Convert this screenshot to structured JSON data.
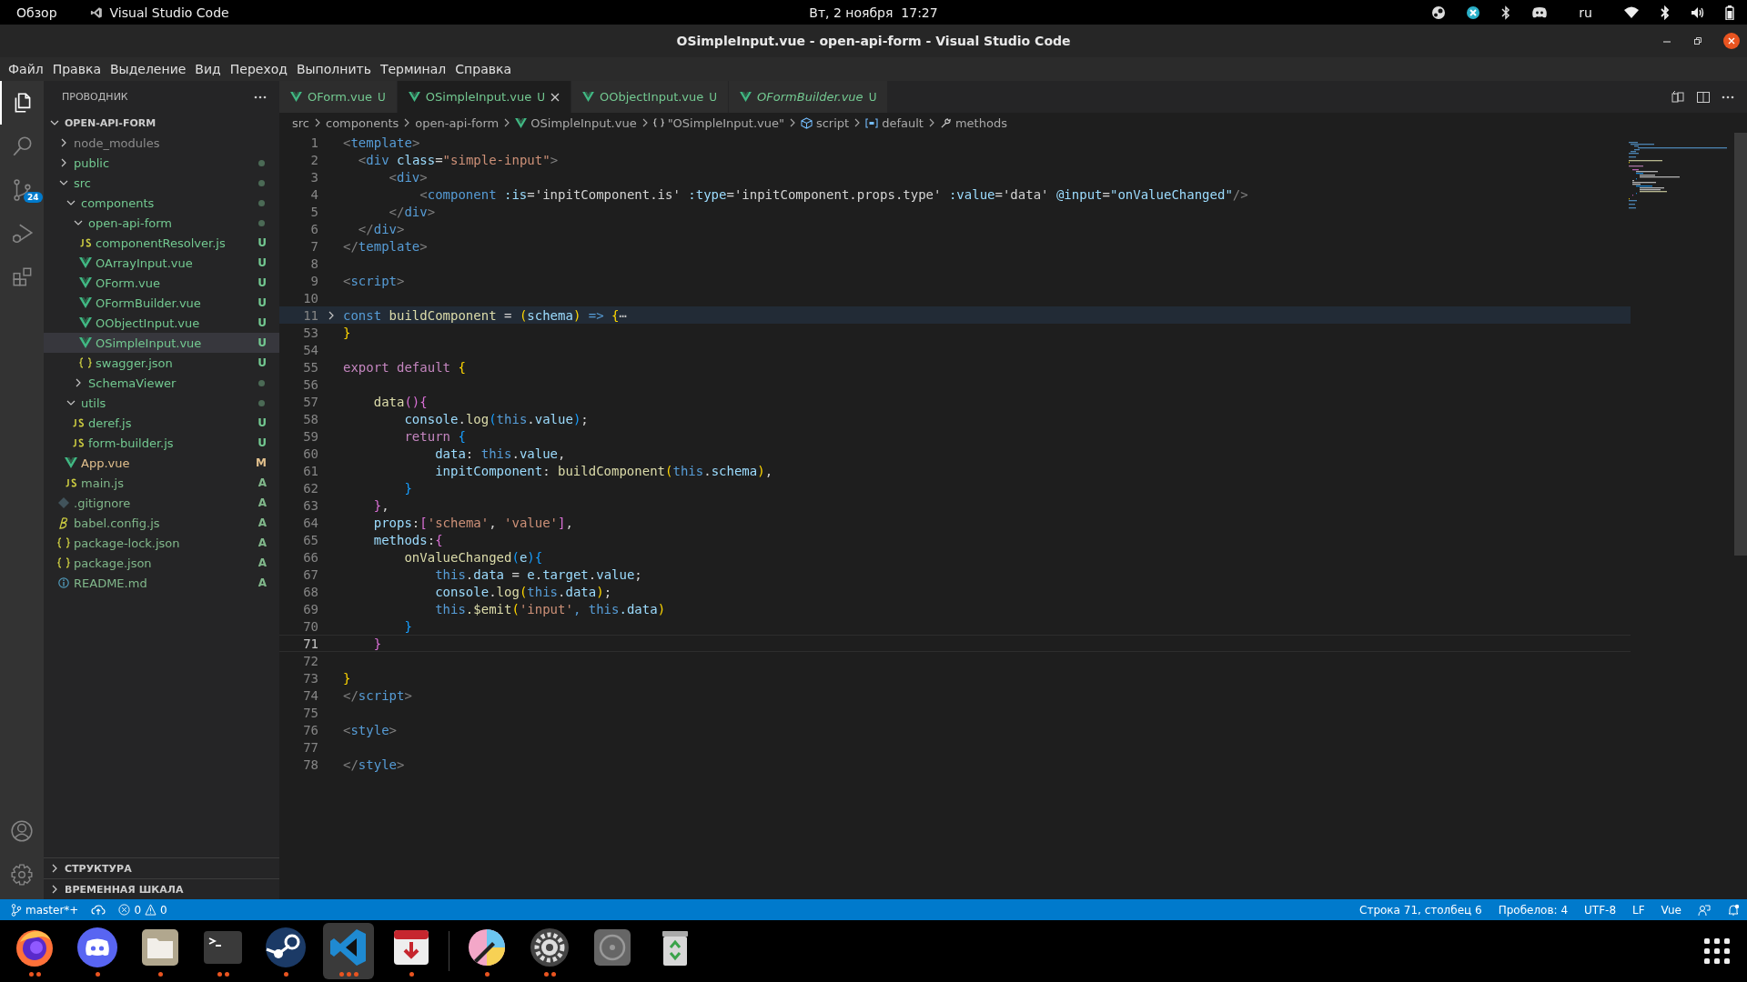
{
  "top_bar": {
    "activities": "Обзор",
    "app": "Visual Studio Code",
    "clock": "Вт, 2 ноября  17:27",
    "keyboard_layout": "ru"
  },
  "window": {
    "title": "OSimpleInput.vue - open-api-form - Visual Studio Code"
  },
  "menu": [
    "Файл",
    "Правка",
    "Выделение",
    "Вид",
    "Переход",
    "Выполнить",
    "Терминал",
    "Справка"
  ],
  "activity_bar": [
    {
      "kind": "explorer",
      "selected": true
    },
    {
      "kind": "search",
      "selected": false
    },
    {
      "kind": "scm",
      "selected": false,
      "badge": "24"
    },
    {
      "kind": "run",
      "selected": false
    },
    {
      "kind": "extensions",
      "selected": false
    }
  ],
  "explorer": {
    "title": "ПРОВОДНИК",
    "root": {
      "name": "OPEN-API-FORM",
      "expanded": true,
      "children": [
        {
          "name": "node_modules",
          "kind": "folder",
          "expanded": false,
          "color": "#8c8c8c",
          "decorated": false,
          "selected": false
        },
        {
          "name": "public",
          "kind": "folder",
          "expanded": false,
          "color": "#73c991",
          "decorated": true,
          "selected": false
        },
        {
          "name": "src",
          "kind": "folder",
          "expanded": true,
          "color": "#73c991",
          "decorated": true,
          "selected": false,
          "children": [
            {
              "name": "components",
              "kind": "folder",
              "expanded": true,
              "color": "#73c991",
              "decorated": true,
              "selected": false,
              "children": [
                {
                  "name": "open-api-form",
                  "kind": "folder",
                  "expanded": true,
                  "color": "#73c991",
                  "decorated": true,
                  "selected": false,
                  "children": [
                    {
                      "name": "componentResolver.js",
                      "kind": "js",
                      "color": "#73c991",
                      "badge": "U",
                      "selected": false
                    },
                    {
                      "name": "OArrayInput.vue",
                      "kind": "vue",
                      "color": "#73c991",
                      "badge": "U",
                      "selected": false
                    },
                    {
                      "name": "OForm.vue",
                      "kind": "vue",
                      "color": "#73c991",
                      "badge": "U",
                      "selected": false
                    },
                    {
                      "name": "OFormBuilder.vue",
                      "kind": "vue",
                      "color": "#73c991",
                      "badge": "U",
                      "selected": false
                    },
                    {
                      "name": "OObjectInput.vue",
                      "kind": "vue",
                      "color": "#73c991",
                      "badge": "U",
                      "selected": false
                    },
                    {
                      "name": "OSimpleInput.vue",
                      "kind": "vue",
                      "color": "#73c991",
                      "badge": "U",
                      "selected": true
                    },
                    {
                      "name": "swagger.json",
                      "kind": "json",
                      "color": "#73c991",
                      "badge": "U",
                      "selected": false
                    }
                  ]
                },
                {
                  "name": "SchemaViewer",
                  "kind": "folder",
                  "expanded": false,
                  "color": "#73c991",
                  "decorated": true,
                  "selected": false
                }
              ]
            },
            {
              "name": "utils",
              "kind": "folder",
              "expanded": true,
              "color": "#73c991",
              "decorated": true,
              "selected": false,
              "children": [
                {
                  "name": "deref.js",
                  "kind": "js",
                  "color": "#73c991",
                  "badge": "U",
                  "selected": false
                },
                {
                  "name": "form-builder.js",
                  "kind": "js",
                  "color": "#73c991",
                  "badge": "U",
                  "selected": false
                }
              ]
            },
            {
              "name": "App.vue",
              "kind": "vue",
              "color": "#e2c08d",
              "badge": "M",
              "selected": false
            },
            {
              "name": "main.js",
              "kind": "js",
              "color": "#81b88b",
              "badge": "A",
              "selected": false
            }
          ]
        },
        {
          "name": ".gitignore",
          "kind": "git",
          "color": "#81b88b",
          "badge": "A",
          "selected": false
        },
        {
          "name": "babel.config.js",
          "kind": "babel",
          "color": "#81b88b",
          "badge": "A",
          "selected": false
        },
        {
          "name": "package-lock.json",
          "kind": "json",
          "color": "#81b88b",
          "badge": "A",
          "selected": false
        },
        {
          "name": "package.json",
          "kind": "json",
          "color": "#81b88b",
          "badge": "A",
          "selected": false
        },
        {
          "name": "README.md",
          "kind": "info",
          "color": "#81b88b",
          "badge": "A",
          "selected": false
        }
      ]
    },
    "sections": [
      {
        "title": "СТРУКТУРА",
        "expanded": false
      },
      {
        "title": "ВРЕМЕННАЯ ШКАЛА",
        "expanded": false
      }
    ]
  },
  "tabs": [
    {
      "label": "OForm.vue",
      "badge": "U",
      "color": "#73c991",
      "selected": false,
      "preview": false
    },
    {
      "label": "OSimpleInput.vue",
      "badge": "U",
      "color": "#73c991",
      "selected": true,
      "preview": false
    },
    {
      "label": "OObjectInput.vue",
      "badge": "U",
      "color": "#73c991",
      "selected": false,
      "preview": false
    },
    {
      "label": "OFormBuilder.vue",
      "badge": "U",
      "color": "#73c991",
      "selected": false,
      "preview": true
    }
  ],
  "breadcrumbs": [
    {
      "label": "src",
      "kind": "folder"
    },
    {
      "label": "components",
      "kind": "folder"
    },
    {
      "label": "open-api-form",
      "kind": "folder"
    },
    {
      "label": "OSimpleInput.vue",
      "kind": "vue"
    },
    {
      "label": "\"OSimpleInput.vue\"",
      "kind": "braces"
    },
    {
      "label": "script",
      "kind": "module"
    },
    {
      "label": "default",
      "kind": "field"
    },
    {
      "label": "methods",
      "kind": "method"
    }
  ],
  "editor": {
    "lines": [
      {
        "number": "1",
        "folded": false,
        "current": false,
        "tokens": [
          {
            "t": "<",
            "kind": "punct"
          },
          {
            "t": "template",
            "kind": "tag"
          },
          {
            "t": ">",
            "kind": "punct"
          }
        ]
      },
      {
        "number": "2",
        "folded": false,
        "current": false,
        "tokens": [
          {
            "t": "  <",
            "kind": "punct"
          },
          {
            "t": "div",
            "kind": "tag"
          },
          {
            "t": " class",
            "kind": "attr"
          },
          {
            "t": "=",
            "kind": "plain"
          },
          {
            "t": "\"simple-input\"",
            "kind": "string"
          },
          {
            "t": ">",
            "kind": "punct"
          }
        ]
      },
      {
        "number": "3",
        "folded": false,
        "current": false,
        "tokens": [
          {
            "t": "      <",
            "kind": "punct"
          },
          {
            "t": "div",
            "kind": "tag"
          },
          {
            "t": ">",
            "kind": "punct"
          }
        ]
      },
      {
        "number": "4",
        "folded": false,
        "current": false,
        "tokens": [
          {
            "t": "          <",
            "kind": "punct"
          },
          {
            "t": "component",
            "kind": "tag"
          },
          {
            "t": " :is",
            "kind": "attr"
          },
          {
            "t": "=",
            "kind": "plain"
          },
          {
            "t": "'inpitComponent.is'",
            "kind": "plain"
          },
          {
            "t": " :type",
            "kind": "attr"
          },
          {
            "t": "=",
            "kind": "plain"
          },
          {
            "t": "'inpitComponent.props.type'",
            "kind": "plain"
          },
          {
            "t": " :value",
            "kind": "attr"
          },
          {
            "t": "=",
            "kind": "plain"
          },
          {
            "t": "'data'",
            "kind": "plain"
          },
          {
            "t": " @input",
            "kind": "attr"
          },
          {
            "t": "=",
            "kind": "plain"
          },
          {
            "t": "\"onValueChanged\"",
            "kind": "variable"
          },
          {
            "t": "/>",
            "kind": "punct"
          }
        ]
      },
      {
        "number": "5",
        "folded": false,
        "current": false,
        "tokens": [
          {
            "t": "      </",
            "kind": "punct"
          },
          {
            "t": "div",
            "kind": "tag"
          },
          {
            "t": ">",
            "kind": "punct"
          }
        ]
      },
      {
        "number": "6",
        "folded": false,
        "current": false,
        "tokens": [
          {
            "t": "  </",
            "kind": "punct"
          },
          {
            "t": "div",
            "kind": "tag"
          },
          {
            "t": ">",
            "kind": "punct"
          }
        ]
      },
      {
        "number": "7",
        "folded": false,
        "current": false,
        "tokens": [
          {
            "t": "</",
            "kind": "punct"
          },
          {
            "t": "template",
            "kind": "tag"
          },
          {
            "t": ">",
            "kind": "punct"
          }
        ]
      },
      {
        "number": "8",
        "folded": false,
        "current": false
      },
      {
        "number": "9",
        "folded": false,
        "current": false,
        "tokens": [
          {
            "t": "<",
            "kind": "punct"
          },
          {
            "t": "script",
            "kind": "tag"
          },
          {
            "t": ">",
            "kind": "punct"
          }
        ]
      },
      {
        "number": "10",
        "folded": false,
        "current": false
      },
      {
        "number": "11",
        "folded": true,
        "current": false,
        "tokens": [
          {
            "t": "const",
            "kind": "keyword"
          },
          {
            "t": " buildComponent",
            "kind": "function"
          },
          {
            "t": " = ",
            "kind": "plain"
          },
          {
            "t": "(",
            "kind": "brace1"
          },
          {
            "t": "schema",
            "kind": "variable"
          },
          {
            "t": ")",
            "kind": "brace1"
          },
          {
            "t": " =>",
            "kind": "keyword"
          },
          {
            "t": " {",
            "kind": "brace1"
          },
          {
            "t": "⋯",
            "kind": "ellipsis"
          }
        ]
      },
      {
        "number": "53",
        "folded": false,
        "current": false,
        "tokens": [
          {
            "t": "}",
            "kind": "brace1"
          }
        ]
      },
      {
        "number": "54",
        "folded": false,
        "current": false
      },
      {
        "number": "55",
        "folded": false,
        "current": false,
        "tokens": [
          {
            "t": "export",
            "kind": "control"
          },
          {
            "t": " default",
            "kind": "control"
          },
          {
            "t": " {",
            "kind": "brace1"
          }
        ]
      },
      {
        "number": "56",
        "folded": false,
        "current": false
      },
      {
        "number": "57",
        "folded": false,
        "current": false,
        "tokens": [
          {
            "t": "    data",
            "kind": "function"
          },
          {
            "t": "(){",
            "kind": "brace2"
          }
        ]
      },
      {
        "number": "58",
        "folded": false,
        "current": false,
        "tokens": [
          {
            "t": "        console",
            "kind": "variable"
          },
          {
            "t": ".",
            "kind": "plain"
          },
          {
            "t": "log",
            "kind": "function"
          },
          {
            "t": "(",
            "kind": "brace3"
          },
          {
            "t": "this",
            "kind": "keyword"
          },
          {
            "t": ".",
            "kind": "plain"
          },
          {
            "t": "value",
            "kind": "variable"
          },
          {
            "t": ")",
            "kind": "brace3"
          },
          {
            "t": ";",
            "kind": "plain"
          }
        ]
      },
      {
        "number": "59",
        "folded": false,
        "current": false,
        "tokens": [
          {
            "t": "        return",
            "kind": "control"
          },
          {
            "t": " {",
            "kind": "brace3"
          }
        ]
      },
      {
        "number": "60",
        "folded": false,
        "current": false,
        "tokens": [
          {
            "t": "            data",
            "kind": "variable"
          },
          {
            "t": ": ",
            "kind": "plain"
          },
          {
            "t": "this",
            "kind": "keyword"
          },
          {
            "t": ".",
            "kind": "plain"
          },
          {
            "t": "value",
            "kind": "variable"
          },
          {
            "t": ",",
            "kind": "plain"
          }
        ]
      },
      {
        "number": "61",
        "folded": false,
        "current": false,
        "tokens": [
          {
            "t": "            inpitComponent",
            "kind": "variable"
          },
          {
            "t": ": ",
            "kind": "plain"
          },
          {
            "t": "buildComponent",
            "kind": "function"
          },
          {
            "t": "(",
            "kind": "brace1"
          },
          {
            "t": "this",
            "kind": "keyword"
          },
          {
            "t": ".",
            "kind": "plain"
          },
          {
            "t": "schema",
            "kind": "variable"
          },
          {
            "t": ")",
            "kind": "brace1"
          },
          {
            "t": ",",
            "kind": "plain"
          }
        ]
      },
      {
        "number": "62",
        "folded": false,
        "current": false,
        "tokens": [
          {
            "t": "        }",
            "kind": "brace3"
          }
        ]
      },
      {
        "number": "63",
        "folded": false,
        "current": false,
        "tokens": [
          {
            "t": "    }",
            "kind": "brace2"
          },
          {
            "t": ",",
            "kind": "plain"
          }
        ]
      },
      {
        "number": "64",
        "folded": false,
        "current": false,
        "tokens": [
          {
            "t": "    props",
            "kind": "variable"
          },
          {
            "t": ":",
            "kind": "plain"
          },
          {
            "t": "[",
            "kind": "brace2"
          },
          {
            "t": "'schema'",
            "kind": "string"
          },
          {
            "t": ", ",
            "kind": "plain"
          },
          {
            "t": "'value'",
            "kind": "string"
          },
          {
            "t": "]",
            "kind": "brace2"
          },
          {
            "t": ",",
            "kind": "plain"
          }
        ]
      },
      {
        "number": "65",
        "folded": false,
        "current": false,
        "tokens": [
          {
            "t": "    methods",
            "kind": "variable"
          },
          {
            "t": ":",
            "kind": "plain"
          },
          {
            "t": "{",
            "kind": "brace2"
          }
        ]
      },
      {
        "number": "66",
        "folded": false,
        "current": false,
        "tokens": [
          {
            "t": "        onValueChanged",
            "kind": "function"
          },
          {
            "t": "(",
            "kind": "brace3"
          },
          {
            "t": "e",
            "kind": "variable"
          },
          {
            "t": "){",
            "kind": "brace3"
          }
        ]
      },
      {
        "number": "67",
        "folded": false,
        "current": false,
        "tokens": [
          {
            "t": "            this",
            "kind": "keyword"
          },
          {
            "t": ".",
            "kind": "plain"
          },
          {
            "t": "data",
            "kind": "variable"
          },
          {
            "t": " = ",
            "kind": "plain"
          },
          {
            "t": "e",
            "kind": "variable"
          },
          {
            "t": ".",
            "kind": "plain"
          },
          {
            "t": "target",
            "kind": "variable"
          },
          {
            "t": ".",
            "kind": "plain"
          },
          {
            "t": "value",
            "kind": "variable"
          },
          {
            "t": ";",
            "kind": "plain"
          }
        ]
      },
      {
        "number": "68",
        "folded": false,
        "current": false,
        "tokens": [
          {
            "t": "            console",
            "kind": "variable"
          },
          {
            "t": ".",
            "kind": "plain"
          },
          {
            "t": "log",
            "kind": "function"
          },
          {
            "t": "(",
            "kind": "brace1"
          },
          {
            "t": "this",
            "kind": "keyword"
          },
          {
            "t": ".",
            "kind": "plain"
          },
          {
            "t": "data",
            "kind": "variable"
          },
          {
            "t": ")",
            "kind": "brace1"
          },
          {
            "t": ";",
            "kind": "plain"
          }
        ]
      },
      {
        "number": "69",
        "folded": false,
        "current": false,
        "tokens": [
          {
            "t": "            this",
            "kind": "keyword"
          },
          {
            "t": ".$emit",
            "kind": "function"
          },
          {
            "t": "(",
            "kind": "brace1"
          },
          {
            "t": "'input'",
            "kind": "string"
          },
          {
            "t": ", this",
            "kind": "keyword"
          },
          {
            "t": ".data",
            "kind": "variable"
          },
          {
            "t": ")",
            "kind": "brace1"
          }
        ]
      },
      {
        "number": "70",
        "folded": false,
        "current": false,
        "tokens": [
          {
            "t": "        }",
            "kind": "brace3"
          }
        ]
      },
      {
        "number": "71",
        "folded": false,
        "current": true,
        "tokens": [
          {
            "t": "    }",
            "kind": "brace2"
          }
        ]
      },
      {
        "number": "72",
        "folded": false,
        "current": false
      },
      {
        "number": "73",
        "folded": false,
        "current": false,
        "tokens": [
          {
            "t": "}",
            "kind": "brace1"
          }
        ]
      },
      {
        "number": "74",
        "folded": false,
        "current": false,
        "tokens": [
          {
            "t": "</",
            "kind": "punct"
          },
          {
            "t": "script",
            "kind": "tag"
          },
          {
            "t": ">",
            "kind": "punct"
          }
        ]
      },
      {
        "number": "75",
        "folded": false,
        "current": false
      },
      {
        "number": "76",
        "folded": false,
        "current": false,
        "tokens": [
          {
            "t": "<",
            "kind": "punct"
          },
          {
            "t": "style",
            "kind": "tag"
          },
          {
            "t": ">",
            "kind": "punct"
          }
        ]
      },
      {
        "number": "77",
        "folded": false,
        "current": false
      },
      {
        "number": "78",
        "folded": false,
        "current": false,
        "tokens": [
          {
            "t": "</",
            "kind": "punct"
          },
          {
            "t": "style",
            "kind": "tag"
          },
          {
            "t": ">",
            "kind": "punct"
          }
        ]
      }
    ]
  },
  "status_bar": {
    "branch": "master*+",
    "errors": "0",
    "warnings": "0",
    "right": [
      "Строка 71, столбец 6",
      "Пробелов: 4",
      "UTF-8",
      "LF",
      "Vue"
    ]
  },
  "dock": [
    {
      "kind": "firefox",
      "selected": false,
      "windows": [
        {
          "open": true
        },
        {
          "open": true
        }
      ]
    },
    {
      "kind": "discord",
      "selected": false,
      "windows": [
        {
          "open": true
        }
      ]
    },
    {
      "kind": "files",
      "selected": false,
      "windows": [
        {
          "open": true
        }
      ]
    },
    {
      "kind": "terminal",
      "selected": false,
      "windows": [
        {
          "open": true
        },
        {
          "open": true
        }
      ]
    },
    {
      "kind": "steam",
      "selected": false,
      "windows": [
        {
          "open": true
        }
      ]
    },
    {
      "kind": "vscode",
      "selected": true,
      "windows": [
        {
          "open": true
        },
        {
          "open": true
        },
        {
          "open": true
        }
      ]
    },
    {
      "kind": "installer",
      "selected": false,
      "windows": [
        {
          "open": true
        }
      ]
    },
    {
      "kind": "paint",
      "selected": false,
      "windows": [
        {
          "open": true
        }
      ]
    },
    {
      "kind": "settings",
      "selected": false,
      "windows": [
        {
          "open": true
        },
        {
          "open": true
        }
      ]
    },
    {
      "kind": "disk",
      "selected": false
    },
    {
      "kind": "trash",
      "selected": false
    }
  ]
}
